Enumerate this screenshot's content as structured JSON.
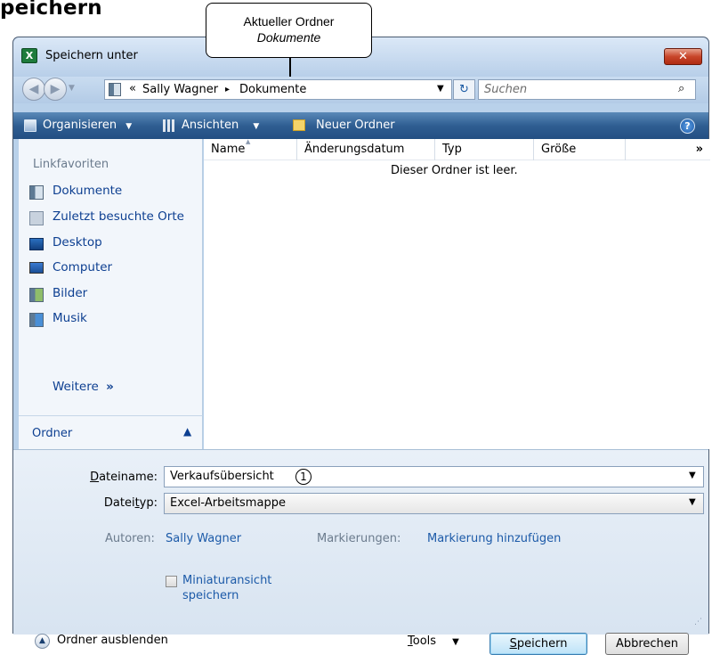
{
  "heading": "peichern",
  "callout": {
    "line1": "Aktueller Ordner",
    "line2": "Dokumente"
  },
  "window": {
    "title": "Speichern unter",
    "app_icon_letter": "X",
    "close_glyph": "✕"
  },
  "nav": {
    "back_glyph": "◀",
    "forward_glyph": "▶",
    "history_glyph": "▼",
    "breadcrumb_overflow": "«",
    "breadcrumb": [
      "Sally Wagner",
      "Dokumente"
    ],
    "breadcrumb_separator": "▸",
    "address_drop_glyph": "▼",
    "refresh_glyph": "↻",
    "search_placeholder": "Suchen",
    "search_glyph": "⌕"
  },
  "toolbar": {
    "organize": "Organisieren",
    "views": "Ansichten",
    "new_folder": "Neuer Ordner",
    "drop_glyph": "▼",
    "help_glyph": "?"
  },
  "sidebar": {
    "header": "Linkfavoriten",
    "items": [
      {
        "label": "Dokumente",
        "icon": "documents-icon"
      },
      {
        "label": "Zuletzt besuchte Orte",
        "icon": "recent-places-icon"
      },
      {
        "label": "Desktop",
        "icon": "desktop-icon"
      },
      {
        "label": "Computer",
        "icon": "computer-icon"
      },
      {
        "label": "Bilder",
        "icon": "pictures-icon"
      },
      {
        "label": "Musik",
        "icon": "music-icon"
      }
    ],
    "more": "Weitere",
    "more_glyph": "»",
    "folder_toggle": "Ordner",
    "folder_caret": "▲"
  },
  "filelist": {
    "columns": [
      "Name",
      "Änderungsdatum",
      "Typ",
      "Größe"
    ],
    "overflow_glyph": "»",
    "sort_glyph": "▲",
    "empty_message": "Dieser Ordner ist leer."
  },
  "form": {
    "filename_label_pre": "",
    "filename_label_u": "D",
    "filename_label_post": "ateiname:",
    "filename_value": "Verkaufsübersicht",
    "step_number": "1",
    "filetype_label_pre": "Datei",
    "filetype_label_u": "t",
    "filetype_label_post": "yp:",
    "filetype_value": "Excel-Arbeitsmappe",
    "drop_glyph": "▼",
    "authors_label": "Autoren:",
    "authors_value": "Sally Wagner",
    "tags_label": "Markierungen:",
    "tags_value": "Markierung hinzufügen",
    "thumbnail_line1": "Miniaturansicht",
    "thumbnail_line2": "speichern",
    "thumbnail_checked": false
  },
  "footer": {
    "hide_folders": "Ordner ausblenden",
    "hide_glyph": "▲",
    "tools_u": "T",
    "tools_rest": "ools",
    "tools_drop": "▼",
    "save_u": "S",
    "save_rest": "peichern",
    "cancel": "Abbrechen",
    "grip_glyph": "⋰"
  }
}
